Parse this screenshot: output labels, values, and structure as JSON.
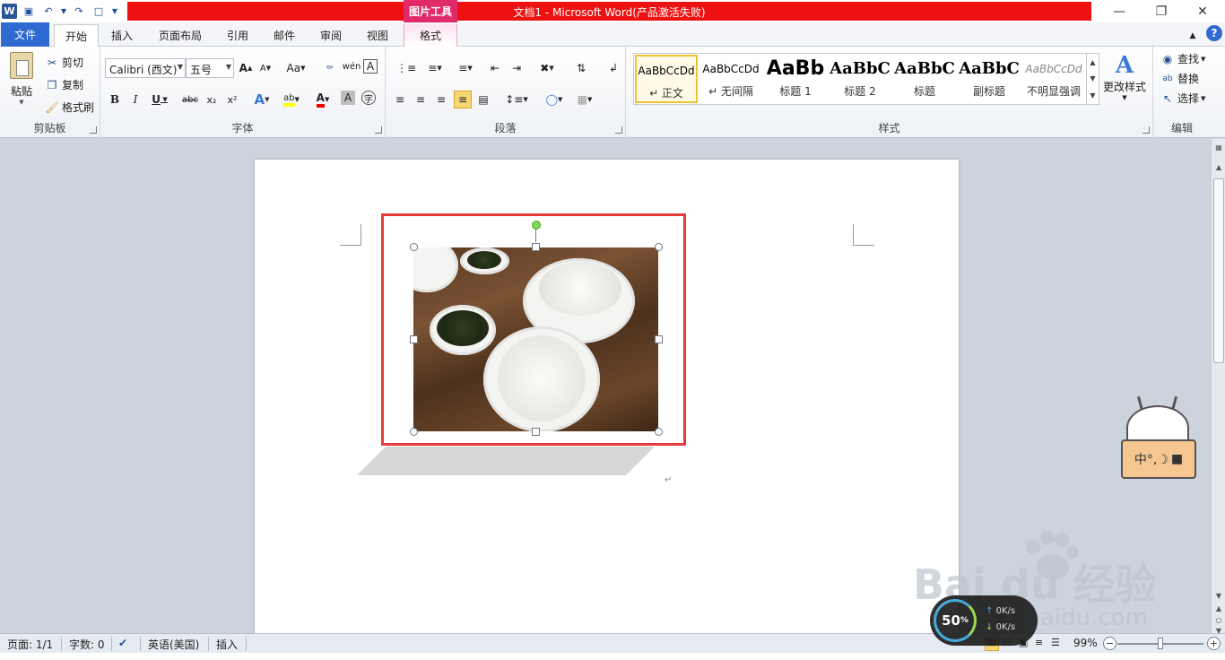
{
  "titlebar": {
    "title": "文档1 - Microsoft Word(产品激活失败)",
    "context_tab_group": "图片工具",
    "word_logo": "W"
  },
  "tabs": {
    "file": "文件",
    "home": "开始",
    "insert": "插入",
    "page_layout": "页面布局",
    "references": "引用",
    "mailings": "邮件",
    "review": "审阅",
    "view": "视图",
    "format": "格式"
  },
  "clipboard": {
    "paste": "粘贴",
    "cut": "剪切",
    "copy": "复制",
    "format_painter": "格式刷",
    "label": "剪贴板"
  },
  "font": {
    "family": "Calibri (西文)",
    "size": "五号",
    "label": "字体",
    "grow": "A",
    "shrink": "A",
    "change_case": "Aa",
    "bold": "B",
    "italic": "I",
    "underline": "U",
    "strikethrough": "abc",
    "subscript": "x₂",
    "superscript": "x²",
    "text_effects": "A",
    "highlight": "ab",
    "font_color": "A",
    "char_shading": "A",
    "pinyin": "wén",
    "char_border": "A",
    "enclose": "字"
  },
  "paragraph": {
    "label": "段落"
  },
  "styles": {
    "label": "样式",
    "change_styles": "更改样式",
    "items": [
      {
        "sample": "AaBbCcDd",
        "name": "↵ 正文"
      },
      {
        "sample": "AaBbCcDd",
        "name": "↵ 无间隔"
      },
      {
        "sample": "AaBb",
        "name": "标题 1"
      },
      {
        "sample": "AaBbC",
        "name": "标题 2"
      },
      {
        "sample": "AaBbC",
        "name": "标题"
      },
      {
        "sample": "AaBbC",
        "name": "副标题"
      },
      {
        "sample": "AaBbCcDd",
        "name": "不明显强调"
      }
    ]
  },
  "editing": {
    "label": "编辑",
    "find": "查找",
    "replace": "替换",
    "select": "选择"
  },
  "document": {
    "paragraph_mark": "↵"
  },
  "statusbar": {
    "page": "页面: 1/1",
    "words": "字数: 0",
    "language": "英语(美国)",
    "mode": "插入",
    "zoom": "99%",
    "zoom_level": 0.5
  },
  "net_widget": {
    "percent": "50",
    "up": "0K/s",
    "down": "0K/s"
  },
  "cat_widget": {
    "text": "中°,☽"
  },
  "watermark": {
    "brand": "Bai du 经验",
    "url": "jingyan.baidu.com"
  },
  "colors": {
    "title_red": "#ee1111",
    "file_tab": "#2e6ad1",
    "selection_frame": "#e53b3b",
    "context_tab": "#e02a6a"
  }
}
